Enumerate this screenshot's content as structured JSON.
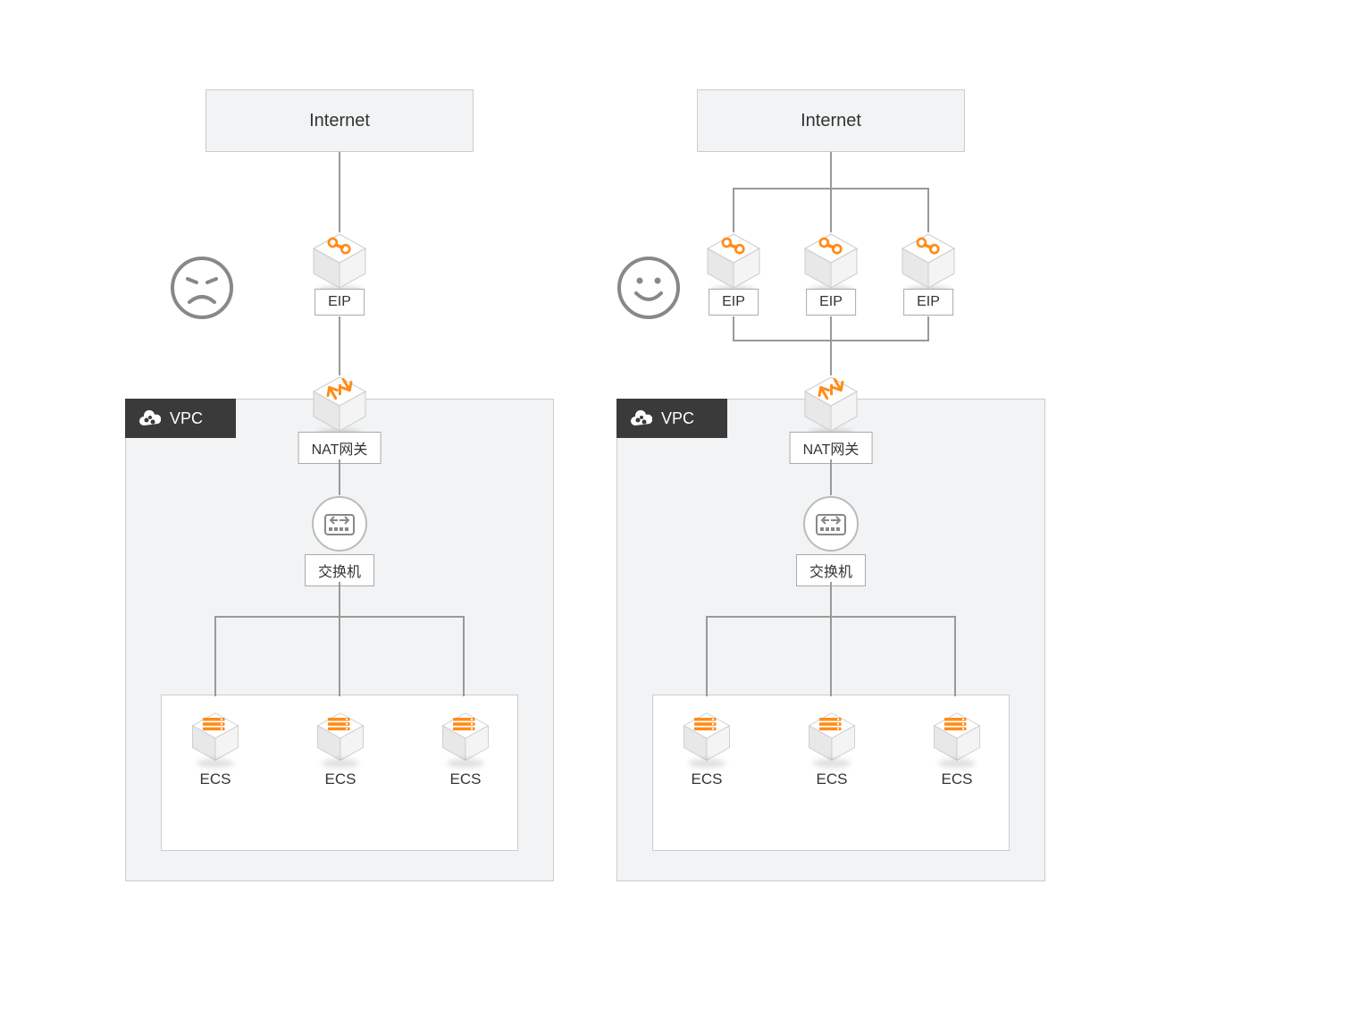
{
  "left": {
    "internet_label": "Internet",
    "eip_label": "EIP",
    "vpc_label": "VPC",
    "nat_label": "NAT网关",
    "switch_label": "交换机",
    "ecs": [
      "ECS",
      "ECS",
      "ECS"
    ],
    "mood": "sad"
  },
  "right": {
    "internet_label": "Internet",
    "eip_labels": [
      "EIP",
      "EIP",
      "EIP"
    ],
    "vpc_label": "VPC",
    "nat_label": "NAT网关",
    "switch_label": "交换机",
    "ecs": [
      "ECS",
      "ECS",
      "ECS"
    ],
    "mood": "happy"
  },
  "colors": {
    "accent": "#ff8c1a",
    "panel_bg": "#f1f3f4",
    "vpc_tab": "#3a3a3a",
    "line": "#999"
  }
}
